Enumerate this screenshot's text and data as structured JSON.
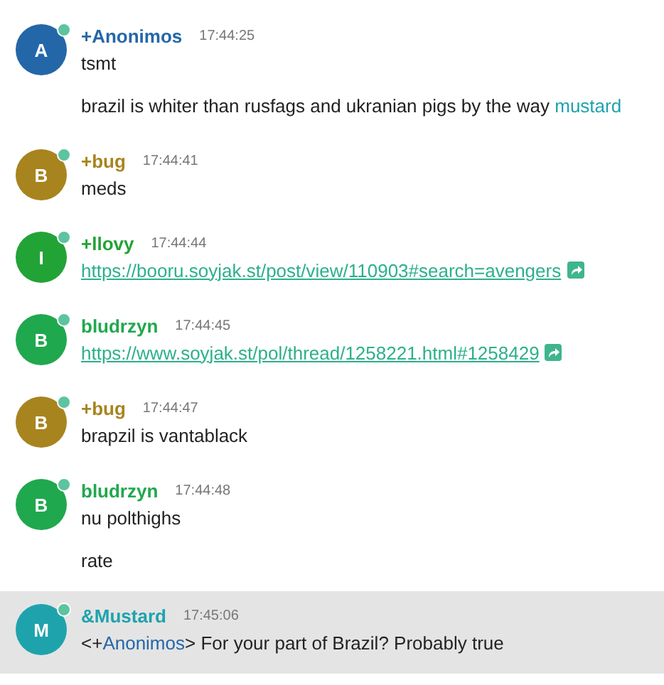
{
  "messages": [
    {
      "avatar": "A",
      "nick": "+Anonimos",
      "color": "#2467a8",
      "time": "17:44:25",
      "highlighted": false,
      "lines": [
        [
          {
            "kind": "text",
            "text": "tsmt"
          }
        ],
        [
          {
            "kind": "text",
            "text": "brazil is whiter than rusfags and ukranian pigs by the way "
          },
          {
            "kind": "nick",
            "text": "mustard",
            "color": "#1ea3ad"
          }
        ]
      ]
    },
    {
      "avatar": "B",
      "nick": "+bug",
      "color": "#a8841f",
      "time": "17:44:41",
      "highlighted": false,
      "lines": [
        [
          {
            "kind": "text",
            "text": "meds"
          }
        ]
      ]
    },
    {
      "avatar": "I",
      "nick": "+llovy",
      "color": "#22a336",
      "time": "17:44:44",
      "highlighted": false,
      "lines": [
        [
          {
            "kind": "link",
            "text": "https://booru.soyjak.st/post/view/110903#search=avengers"
          }
        ]
      ]
    },
    {
      "avatar": "B",
      "nick": "bludrzyn",
      "color": "#20a84e",
      "time": "17:44:45",
      "highlighted": false,
      "lines": [
        [
          {
            "kind": "link",
            "text": "https://www.soyjak.st/pol/thread/1258221.html#1258429"
          }
        ]
      ]
    },
    {
      "avatar": "B",
      "nick": "+bug",
      "color": "#a8841f",
      "time": "17:44:47",
      "highlighted": false,
      "lines": [
        [
          {
            "kind": "text",
            "text": "brapzil is vantablack"
          }
        ]
      ]
    },
    {
      "avatar": "B",
      "nick": "bludrzyn",
      "color": "#20a84e",
      "time": "17:44:48",
      "highlighted": false,
      "lines": [
        [
          {
            "kind": "text",
            "text": "nu polthighs"
          }
        ],
        [
          {
            "kind": "text",
            "text": "rate"
          }
        ]
      ]
    },
    {
      "avatar": "M",
      "nick": "&Mustard",
      "color": "#1ea3ad",
      "time": "17:45:06",
      "highlighted": true,
      "lines": [
        [
          {
            "kind": "text",
            "text": "<+"
          },
          {
            "kind": "nick",
            "text": "Anonimos",
            "color": "#2467a8"
          },
          {
            "kind": "text",
            "text": "> For your part of Brazil? Probably true"
          }
        ]
      ]
    }
  ]
}
